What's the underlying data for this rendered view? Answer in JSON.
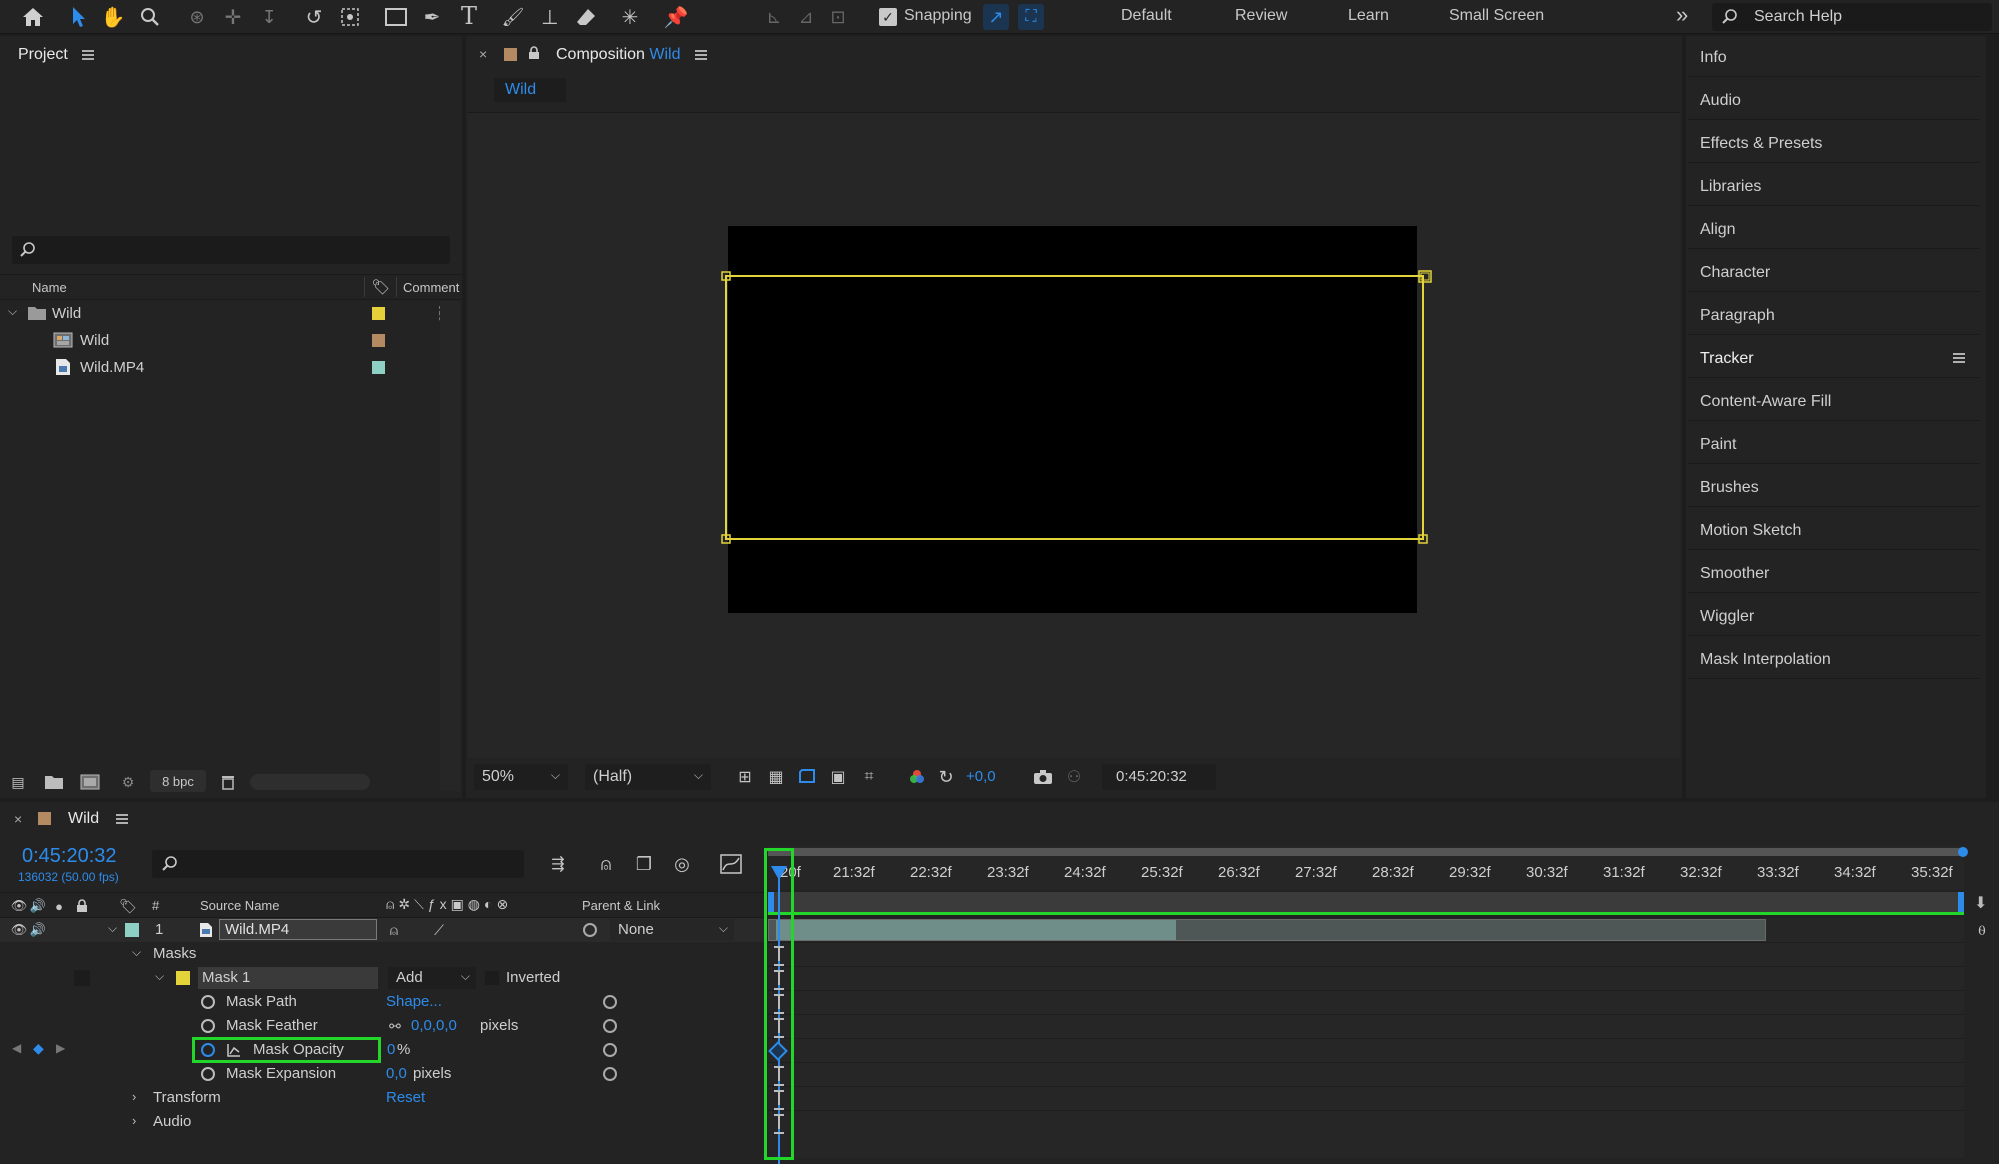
{
  "colors": {
    "accent": "#2d8ceb",
    "highlight": "#23d62a",
    "mask": "#e3d43a",
    "panel": "#232323"
  },
  "toolbar": {
    "snapping_label": "Snapping",
    "workspaces": [
      "Default",
      "Review",
      "Learn",
      "Small Screen"
    ],
    "more_label": "»",
    "search_placeholder": "Search Help"
  },
  "project": {
    "title": "Project",
    "col_name": "Name",
    "col_comment": "Comment",
    "items": [
      {
        "name": "Wild",
        "kind": "folder",
        "color": "#e6d13a"
      },
      {
        "name": "Wild",
        "kind": "composition",
        "color": "#b38a62"
      },
      {
        "name": "Wild.MP4",
        "kind": "footage",
        "color": "#8fd0c4"
      }
    ],
    "bpc_label": "8 bpc"
  },
  "composition": {
    "tab_prefix": "Composition",
    "tab_name": "Wild",
    "subtab": "Wild",
    "zoom": "50%",
    "resolution": "(Half)",
    "exposure": "+0,0",
    "timecode": "0:45:20:32"
  },
  "right_panel": {
    "items": [
      "Info",
      "Audio",
      "Effects & Presets",
      "Libraries",
      "Align",
      "Character",
      "Paragraph",
      "Tracker",
      "Content-Aware Fill",
      "Paint",
      "Brushes",
      "Motion Sketch",
      "Smoother",
      "Wiggler",
      "Mask Interpolation"
    ],
    "active": "Tracker"
  },
  "timeline": {
    "tab_name": "Wild",
    "timecode": "0:45:20:32",
    "frame_info": "136032 (50.00 fps)",
    "col_hash": "#",
    "col_source": "Source Name",
    "col_parent": "Parent & Link",
    "layer_num": "1",
    "layer_name": "Wild.MP4",
    "parent_value": "None",
    "masks_label": "Masks",
    "mask1_label": "Mask 1",
    "mask_mode": "Add",
    "inverted_label": "Inverted",
    "props": [
      {
        "name": "Mask Path",
        "value": "Shape...",
        "unit": ""
      },
      {
        "name": "Mask Feather",
        "value": "0,0,0,0",
        "unit": "pixels"
      },
      {
        "name": "Mask Opacity",
        "value": "0",
        "unit": "%"
      },
      {
        "name": "Mask Expansion",
        "value": "0,0",
        "unit": "pixels"
      }
    ],
    "transform_label": "Transform",
    "transform_value": "Reset",
    "audio_label": "Audio",
    "ruler": [
      "20f",
      "21:32f",
      "22:32f",
      "23:32f",
      "24:32f",
      "25:32f",
      "26:32f",
      "27:32f",
      "28:32f",
      "29:32f",
      "30:32f",
      "31:32f",
      "32:32f",
      "33:32f",
      "34:32f",
      "35:32f"
    ]
  }
}
